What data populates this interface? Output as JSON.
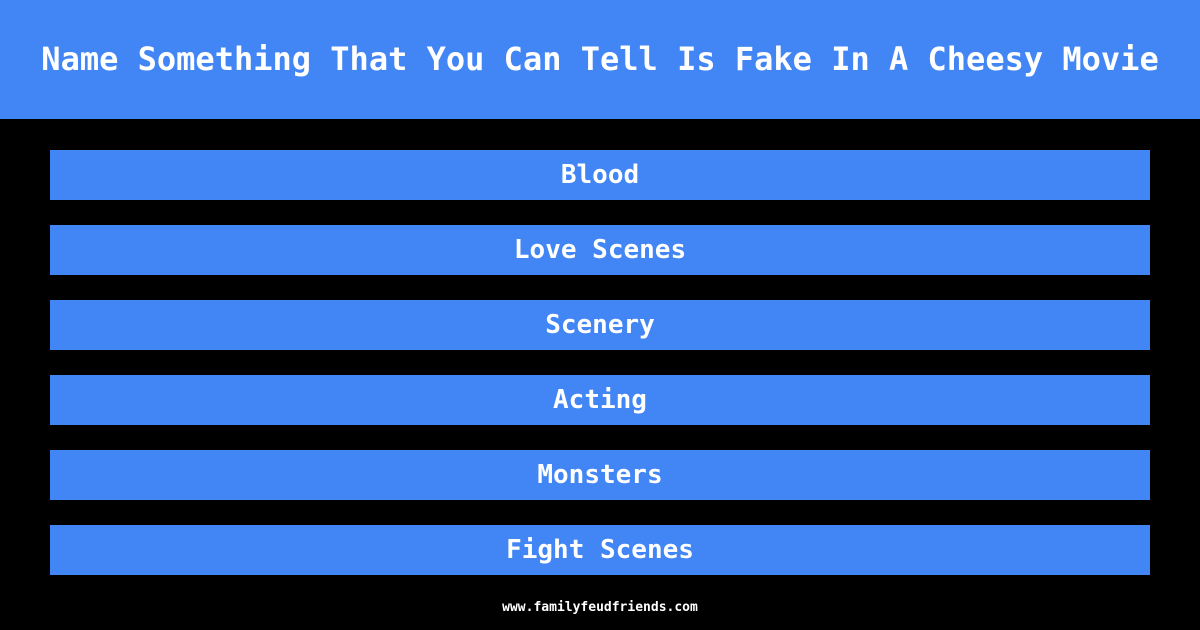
{
  "theme": {
    "background_color": "#000000",
    "accent_color": "#4285f4",
    "text_color": "#ffffff"
  },
  "header": {
    "question": "Name Something That You Can Tell Is Fake In A Cheesy Movie"
  },
  "answers": [
    {
      "rank": 1,
      "text": "Blood"
    },
    {
      "rank": 2,
      "text": "Love Scenes"
    },
    {
      "rank": 3,
      "text": "Scenery"
    },
    {
      "rank": 4,
      "text": "Acting"
    },
    {
      "rank": 5,
      "text": "Monsters"
    },
    {
      "rank": 6,
      "text": "Fight Scenes"
    }
  ],
  "footer": {
    "website": "www.familyfeudfriends.com"
  }
}
